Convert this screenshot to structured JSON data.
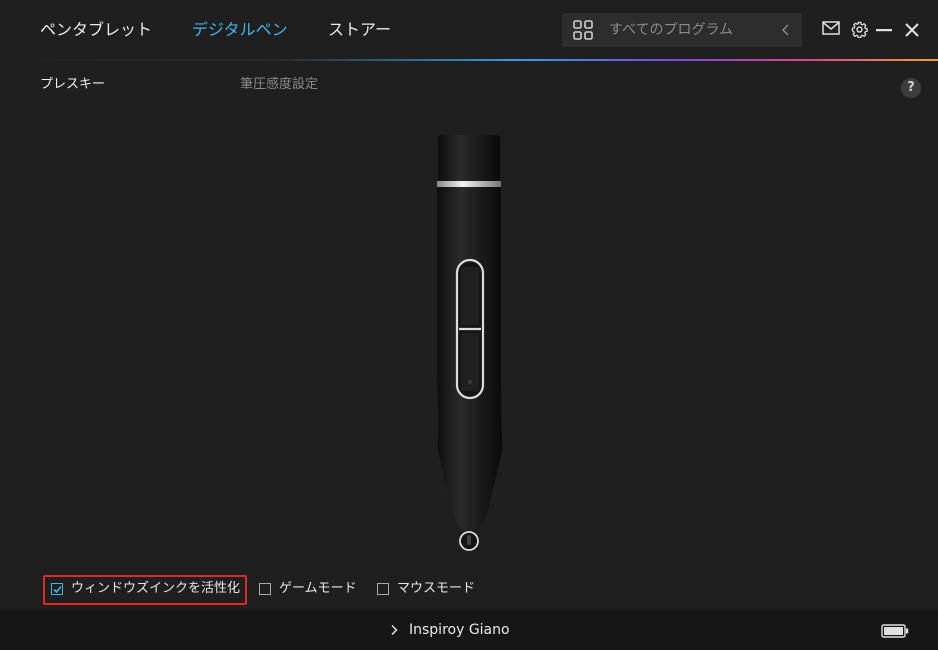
{
  "nav": {
    "tabs": [
      {
        "label": "ペンタブレット",
        "active": false
      },
      {
        "label": "デジタルペン",
        "active": true
      },
      {
        "label": "ストアー",
        "active": false
      }
    ]
  },
  "search": {
    "placeholder": "すべてのプログラム"
  },
  "header_icons": [
    "grid-icon",
    "chevron-left-icon",
    "mail-icon",
    "gear-icon",
    "minimize-icon",
    "close-icon"
  ],
  "subtabs": [
    {
      "label": "プレスキー",
      "active": true
    },
    {
      "label": "筆圧感度設定",
      "active": false
    }
  ],
  "help": {
    "label": "?"
  },
  "options": [
    {
      "label": "ウィンドウズインクを活性化",
      "checked": true,
      "highlighted": true
    },
    {
      "label": "ゲームモード",
      "checked": false
    },
    {
      "label": "マウスモード",
      "checked": false
    }
  ],
  "footer": {
    "device_name": "Inspiroy Giano"
  },
  "colors": {
    "accent": "#3fb6e8",
    "highlight": "#e02a2a",
    "background": "#1f1f1f",
    "footer": "#161616"
  }
}
